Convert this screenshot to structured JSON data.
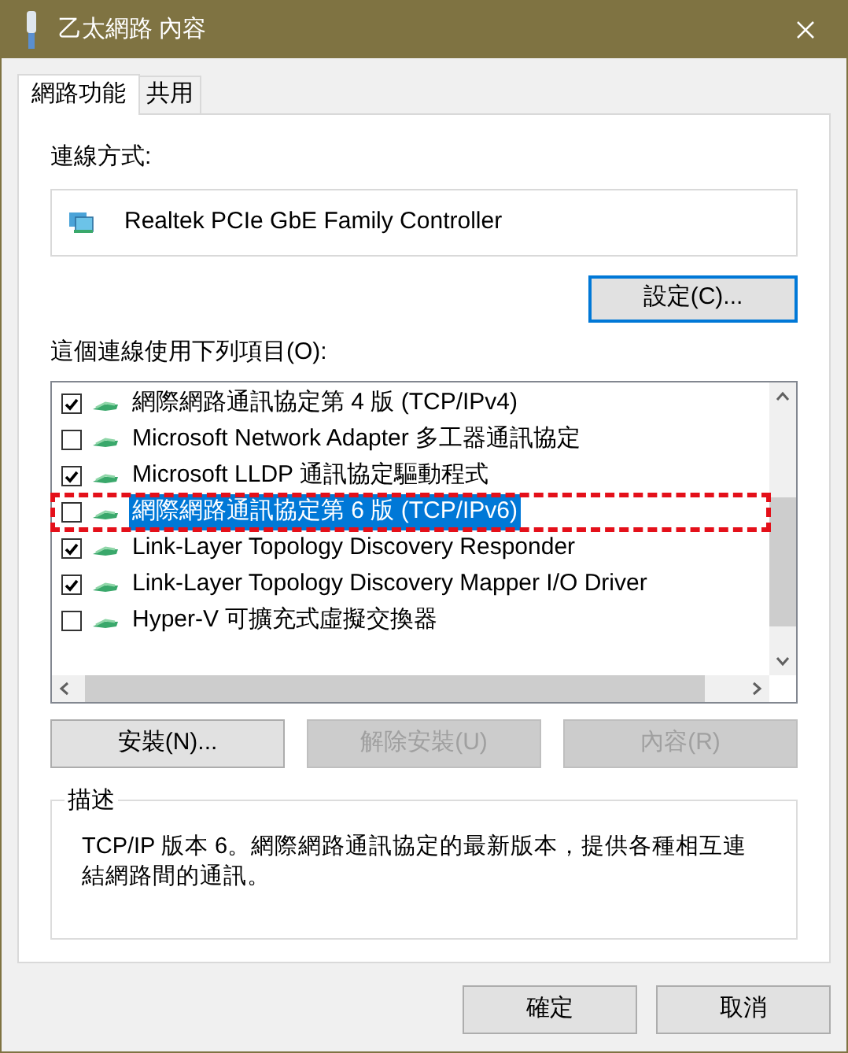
{
  "window": {
    "title": "乙太網路 內容"
  },
  "tabs": [
    {
      "label": "網路功能",
      "selected": true
    },
    {
      "label": "共用",
      "selected": false
    }
  ],
  "connect_using": {
    "label": "連線方式:",
    "adapter": "Realtek PCIe GbE Family Controller",
    "configure_button": {
      "label": "設定(C)...",
      "focused": true
    }
  },
  "items_label": "這個連線使用下列項目(O):",
  "items": [
    {
      "label": "網際網路通訊協定第 4 版 (TCP/IPv4)",
      "checked": true,
      "selected": false,
      "annotated": false
    },
    {
      "label": "Microsoft Network Adapter 多工器通訊協定",
      "checked": false,
      "selected": false,
      "annotated": false
    },
    {
      "label": "Microsoft LLDP 通訊協定驅動程式",
      "checked": true,
      "selected": false,
      "annotated": false
    },
    {
      "label": "網際網路通訊協定第 6 版 (TCP/IPv6)",
      "checked": false,
      "selected": true,
      "annotated": true
    },
    {
      "label": "Link-Layer Topology Discovery Responder",
      "checked": true,
      "selected": false,
      "annotated": false
    },
    {
      "label": "Link-Layer Topology Discovery Mapper I/O Driver",
      "checked": true,
      "selected": false,
      "annotated": false
    },
    {
      "label": "Hyper-V 可擴充式虛擬交換器",
      "checked": false,
      "selected": false,
      "annotated": false
    }
  ],
  "item_buttons": [
    {
      "label": "安裝(N)...",
      "disabled": false
    },
    {
      "label": "解除安裝(U)",
      "disabled": true
    },
    {
      "label": "內容(R)",
      "disabled": true
    }
  ],
  "description": {
    "title": "描述",
    "text": "TCP/IP 版本 6。網際網路通訊協定的最新版本，提供各種相互連結網路間的通訊。"
  },
  "dialog_buttons": [
    {
      "label": "確定"
    },
    {
      "label": "取消"
    }
  ]
}
